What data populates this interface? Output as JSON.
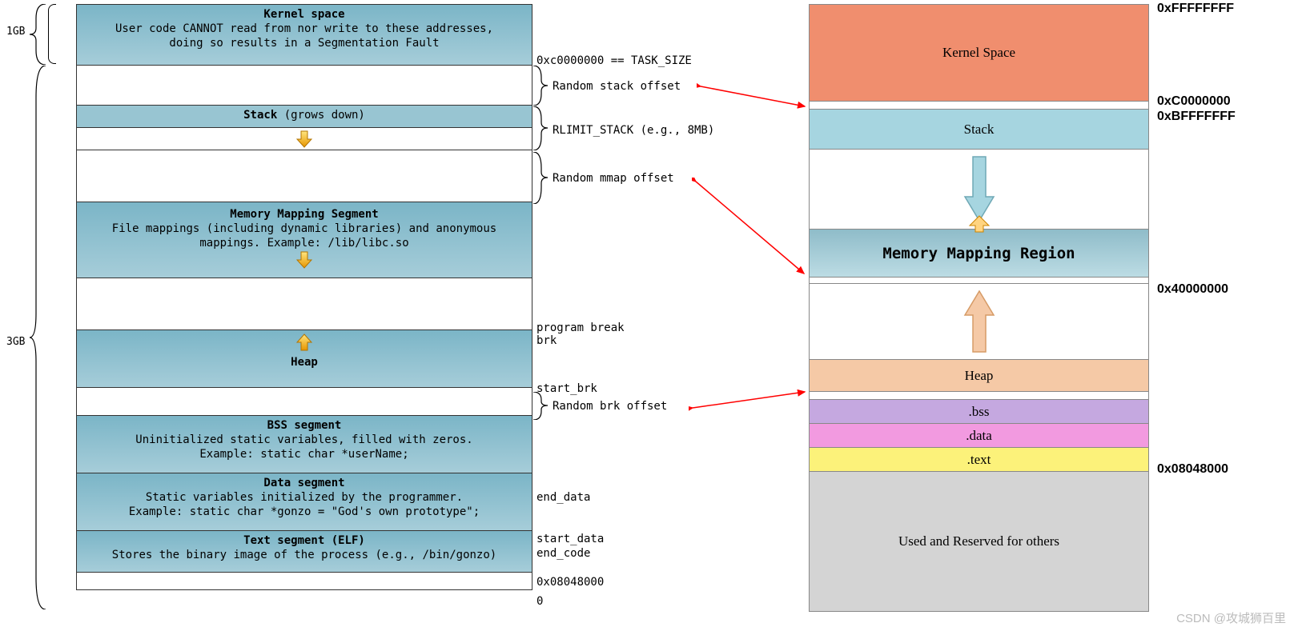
{
  "left_braces": {
    "kernel_size": "1GB",
    "user_size": "3GB"
  },
  "left_segments": {
    "kernel": {
      "title": "Kernel space",
      "desc1": "User code CANNOT read from nor write to these addresses,",
      "desc2": "doing so results in a Segmentation Fault"
    },
    "stack": {
      "title": "Stack (grows down)"
    },
    "mmap": {
      "title": "Memory Mapping Segment",
      "desc1": "File mappings (including dynamic libraries) and anonymous",
      "desc2": "mappings. Example: /lib/libc.so"
    },
    "heap": {
      "title": "Heap"
    },
    "bss": {
      "title": "BSS segment",
      "desc1": "Uninitialized static variables, filled with zeros.",
      "desc2": "Example: static char *userName;"
    },
    "data": {
      "title": "Data segment",
      "desc1": "Static variables initialized by the programmer.",
      "desc2": "Example: static char *gonzo = \"God's own prototype\";"
    },
    "text": {
      "title": "Text segment (ELF)",
      "desc": "Stores the binary image of the process (e.g., /bin/gonzo)"
    }
  },
  "left_annotations": {
    "task_size": "0xc0000000 == TASK_SIZE",
    "rand_stack": "Random stack offset",
    "rlimit": "RLIMIT_STACK (e.g., 8MB)",
    "rand_mmap": "Random mmap offset",
    "prog_break1": "program break",
    "prog_break2": "brk",
    "start_brk": "start_brk",
    "rand_brk": "Random brk offset",
    "end_data": "end_data",
    "start_data": "start_data",
    "end_code": "end_code",
    "base_addr": "0x08048000",
    "zero": "0"
  },
  "right_segments": {
    "kernel": "Kernel Space",
    "stack": "Stack",
    "mmr": "Memory Mapping Region",
    "heap": "Heap",
    "bss": ".bss",
    "data": ".data",
    "text": ".text",
    "reserved": "Used and Reserved for others"
  },
  "right_addrs": {
    "a1": "0xFFFFFFFF",
    "a2": "0xC0000000",
    "a3": "0xBFFFFFFF",
    "a4": "0x40000000",
    "a5": "0x08048000"
  },
  "watermark": "CSDN @攻城狮百里"
}
